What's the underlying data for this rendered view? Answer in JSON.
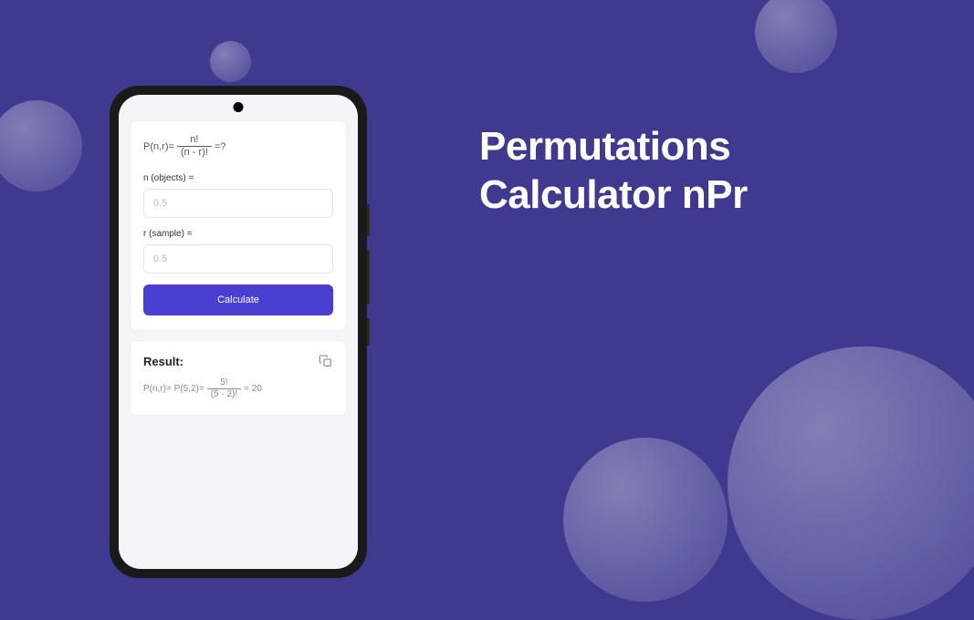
{
  "headline": {
    "line1": "Permutations",
    "line2": "Calculator nPr"
  },
  "app": {
    "formula": {
      "lhs": "P(n,r)=",
      "numerator": "n!",
      "denominator": "(n - r)!",
      "rhs": "=?"
    },
    "fields": {
      "n": {
        "label": "n (objects) =",
        "placeholder": "0.5"
      },
      "r": {
        "label": "r (sample) =",
        "placeholder": "0.5"
      }
    },
    "calculate_label": "Calculate",
    "result": {
      "title": "Result:",
      "expr_prefix": "P(n,r)= P(5,2)=",
      "numerator": "5!",
      "denominator": "(5 - 2)!",
      "value_suffix": "= 20"
    }
  },
  "colors": {
    "background": "#3f3a8f",
    "accent": "#4a3fd1"
  }
}
